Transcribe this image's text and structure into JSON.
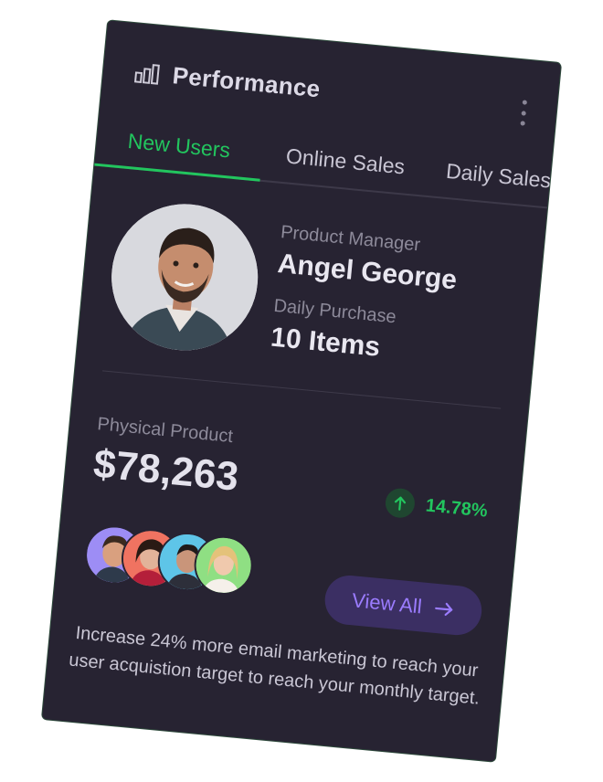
{
  "header": {
    "title": "Performance",
    "icon": "bar-chart-icon"
  },
  "tabs": [
    {
      "label": "New Users",
      "active": true
    },
    {
      "label": "Online Sales",
      "active": false
    },
    {
      "label": "Daily Sales",
      "active": false
    }
  ],
  "profile": {
    "role_label": "Product Manager",
    "name": "Angel George",
    "purchase_label": "Daily Purchase",
    "purchase_value": "10 Items"
  },
  "product": {
    "label": "Physical Product",
    "value": "$78,263",
    "change": "14.78%",
    "trend": "up"
  },
  "button": {
    "view_all": "View All"
  },
  "description": "Increase 24% more email marketing to reach your user acquistion target to reach  your monthly target.",
  "colors": {
    "card_bg": "#272332",
    "accent_green": "#22c55e",
    "accent_purple": "#9b7cff",
    "button_bg": "#3b2f63"
  }
}
